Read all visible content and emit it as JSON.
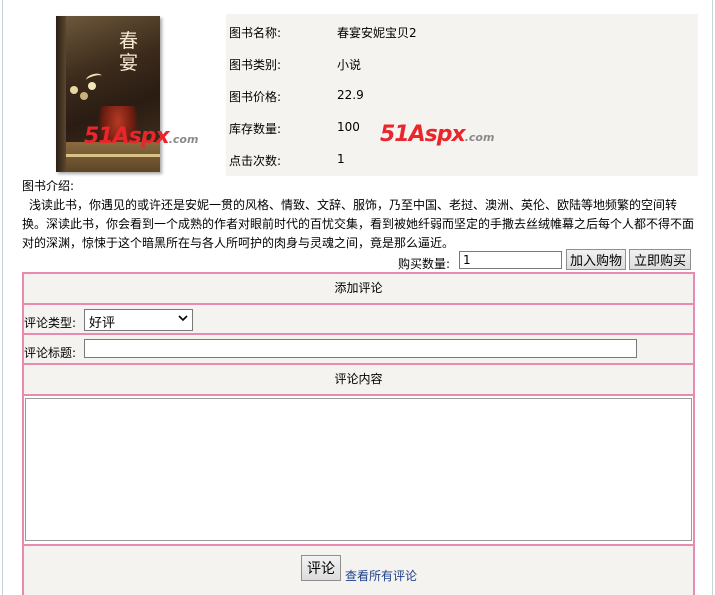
{
  "book": {
    "cover_title": "春宴",
    "watermark": {
      "n": "51",
      "a": "Aspx",
      "rest": ".com"
    },
    "fields": [
      {
        "label": "图书名称:",
        "value": "春宴安妮宝贝2"
      },
      {
        "label": "图书类别:",
        "value": "小说"
      },
      {
        "label": "图书价格:",
        "value": "22.9"
      },
      {
        "label": "库存数量:",
        "value": "100"
      },
      {
        "label": "点击次数:",
        "value": "1"
      }
    ],
    "intro_label": "图书介绍:",
    "intro_text": "浅读此书，你遇见的或许还是安妮一贯的风格、情致、文辞、服饰，乃至中国、老挝、澳洲、英伦、欧陆等地频繁的空间转换。深读此书，你会看到一个成熟的作者对眼前时代的百忧交集，看到被她纤弱而坚定的手撒去丝绒帷幕之后每个人都不得不面对的深渊，惊悚于这个暗黑所在与各人所呵护的肉身与灵魂之间，竟是那么逼近。"
  },
  "purchase": {
    "quantity_label": "购买数量:",
    "quantity_value": "1",
    "add_to_cart_label": "加入购物",
    "buy_now_label": "立即购买"
  },
  "comment": {
    "header": "添加评论",
    "type_label": "评论类型:",
    "type_selected": "好评",
    "title_label": "评论标题:",
    "title_value": "",
    "content_header": "评论内容",
    "content_value": "",
    "submit_label": "评论",
    "view_all_label": "查看所有评论"
  },
  "colors": {
    "table_border": "#e98bb0",
    "panel_bg": "#f5f3f0",
    "link": "#1c3f8c",
    "watermark_red": "#e8262c"
  }
}
